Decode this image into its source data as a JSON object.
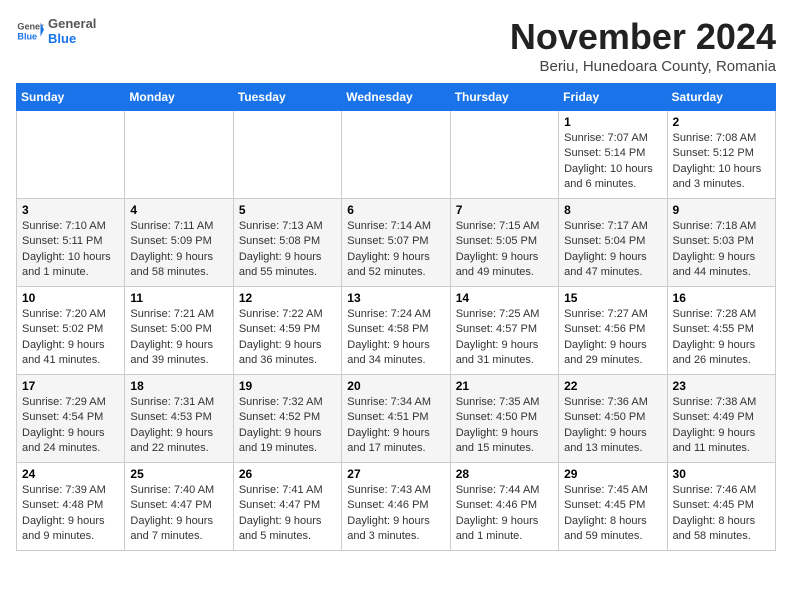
{
  "header": {
    "logo_general": "General",
    "logo_blue": "Blue",
    "month_title": "November 2024",
    "subtitle": "Beriu, Hunedoara County, Romania"
  },
  "weekdays": [
    "Sunday",
    "Monday",
    "Tuesday",
    "Wednesday",
    "Thursday",
    "Friday",
    "Saturday"
  ],
  "weeks": [
    [
      {
        "day": "",
        "info": ""
      },
      {
        "day": "",
        "info": ""
      },
      {
        "day": "",
        "info": ""
      },
      {
        "day": "",
        "info": ""
      },
      {
        "day": "",
        "info": ""
      },
      {
        "day": "1",
        "info": "Sunrise: 7:07 AM\nSunset: 5:14 PM\nDaylight: 10 hours and 6 minutes."
      },
      {
        "day": "2",
        "info": "Sunrise: 7:08 AM\nSunset: 5:12 PM\nDaylight: 10 hours and 3 minutes."
      }
    ],
    [
      {
        "day": "3",
        "info": "Sunrise: 7:10 AM\nSunset: 5:11 PM\nDaylight: 10 hours and 1 minute."
      },
      {
        "day": "4",
        "info": "Sunrise: 7:11 AM\nSunset: 5:09 PM\nDaylight: 9 hours and 58 minutes."
      },
      {
        "day": "5",
        "info": "Sunrise: 7:13 AM\nSunset: 5:08 PM\nDaylight: 9 hours and 55 minutes."
      },
      {
        "day": "6",
        "info": "Sunrise: 7:14 AM\nSunset: 5:07 PM\nDaylight: 9 hours and 52 minutes."
      },
      {
        "day": "7",
        "info": "Sunrise: 7:15 AM\nSunset: 5:05 PM\nDaylight: 9 hours and 49 minutes."
      },
      {
        "day": "8",
        "info": "Sunrise: 7:17 AM\nSunset: 5:04 PM\nDaylight: 9 hours and 47 minutes."
      },
      {
        "day": "9",
        "info": "Sunrise: 7:18 AM\nSunset: 5:03 PM\nDaylight: 9 hours and 44 minutes."
      }
    ],
    [
      {
        "day": "10",
        "info": "Sunrise: 7:20 AM\nSunset: 5:02 PM\nDaylight: 9 hours and 41 minutes."
      },
      {
        "day": "11",
        "info": "Sunrise: 7:21 AM\nSunset: 5:00 PM\nDaylight: 9 hours and 39 minutes."
      },
      {
        "day": "12",
        "info": "Sunrise: 7:22 AM\nSunset: 4:59 PM\nDaylight: 9 hours and 36 minutes."
      },
      {
        "day": "13",
        "info": "Sunrise: 7:24 AM\nSunset: 4:58 PM\nDaylight: 9 hours and 34 minutes."
      },
      {
        "day": "14",
        "info": "Sunrise: 7:25 AM\nSunset: 4:57 PM\nDaylight: 9 hours and 31 minutes."
      },
      {
        "day": "15",
        "info": "Sunrise: 7:27 AM\nSunset: 4:56 PM\nDaylight: 9 hours and 29 minutes."
      },
      {
        "day": "16",
        "info": "Sunrise: 7:28 AM\nSunset: 4:55 PM\nDaylight: 9 hours and 26 minutes."
      }
    ],
    [
      {
        "day": "17",
        "info": "Sunrise: 7:29 AM\nSunset: 4:54 PM\nDaylight: 9 hours and 24 minutes."
      },
      {
        "day": "18",
        "info": "Sunrise: 7:31 AM\nSunset: 4:53 PM\nDaylight: 9 hours and 22 minutes."
      },
      {
        "day": "19",
        "info": "Sunrise: 7:32 AM\nSunset: 4:52 PM\nDaylight: 9 hours and 19 minutes."
      },
      {
        "day": "20",
        "info": "Sunrise: 7:34 AM\nSunset: 4:51 PM\nDaylight: 9 hours and 17 minutes."
      },
      {
        "day": "21",
        "info": "Sunrise: 7:35 AM\nSunset: 4:50 PM\nDaylight: 9 hours and 15 minutes."
      },
      {
        "day": "22",
        "info": "Sunrise: 7:36 AM\nSunset: 4:50 PM\nDaylight: 9 hours and 13 minutes."
      },
      {
        "day": "23",
        "info": "Sunrise: 7:38 AM\nSunset: 4:49 PM\nDaylight: 9 hours and 11 minutes."
      }
    ],
    [
      {
        "day": "24",
        "info": "Sunrise: 7:39 AM\nSunset: 4:48 PM\nDaylight: 9 hours and 9 minutes."
      },
      {
        "day": "25",
        "info": "Sunrise: 7:40 AM\nSunset: 4:47 PM\nDaylight: 9 hours and 7 minutes."
      },
      {
        "day": "26",
        "info": "Sunrise: 7:41 AM\nSunset: 4:47 PM\nDaylight: 9 hours and 5 minutes."
      },
      {
        "day": "27",
        "info": "Sunrise: 7:43 AM\nSunset: 4:46 PM\nDaylight: 9 hours and 3 minutes."
      },
      {
        "day": "28",
        "info": "Sunrise: 7:44 AM\nSunset: 4:46 PM\nDaylight: 9 hours and 1 minute."
      },
      {
        "day": "29",
        "info": "Sunrise: 7:45 AM\nSunset: 4:45 PM\nDaylight: 8 hours and 59 minutes."
      },
      {
        "day": "30",
        "info": "Sunrise: 7:46 AM\nSunset: 4:45 PM\nDaylight: 8 hours and 58 minutes."
      }
    ]
  ]
}
